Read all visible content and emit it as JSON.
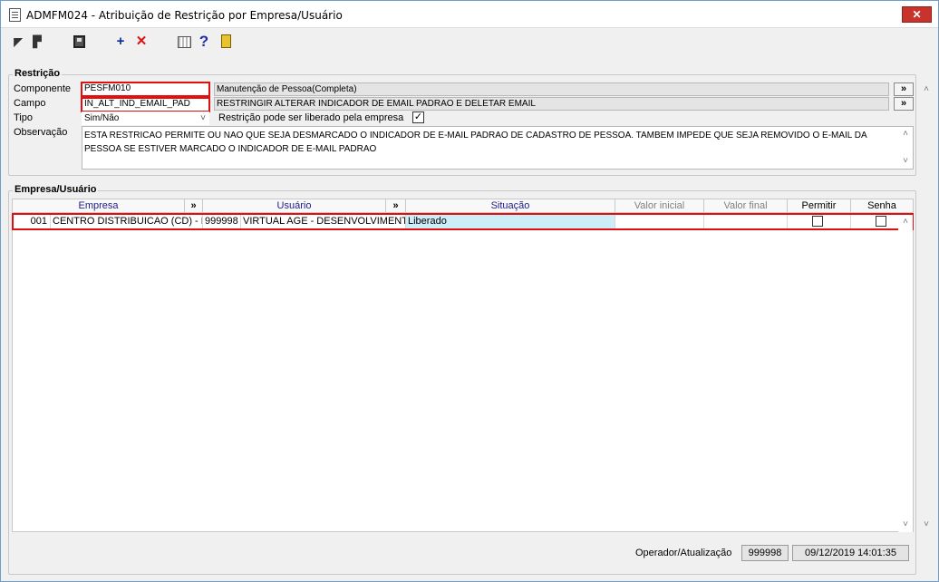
{
  "window": {
    "title": "ADMFM024 - Atribuição de Restrição por Empresa/Usuário",
    "close_glyph": "✕"
  },
  "toolbar": {
    "icons": [
      "first-record-icon",
      "previous-record-icon",
      "save-icon",
      "add-icon",
      "delete-icon",
      "calendar-icon",
      "help-icon",
      "exit-icon"
    ],
    "plus": "+",
    "x": "✕",
    "help": "?"
  },
  "restricao": {
    "group_title": "Restrição",
    "componente_label": "Componente",
    "componente_value": "PESFM010",
    "componente_desc": "Manutenção de Pessoa(Completa)",
    "campo_label": "Campo",
    "campo_value": "IN_ALT_IND_EMAIL_PAD",
    "campo_desc": "RESTRINGIR ALTERAR INDICADOR DE EMAIL PADRAO E DELETAR EMAIL",
    "tipo_label": "Tipo",
    "tipo_value": "Sim/Não",
    "liberado_label": "Restrição pode ser liberado pela empresa",
    "liberado_checked": true,
    "observacao_label": "Observação",
    "observacao_text": "ESTA RESTRICAO PERMITE OU NAO QUE SEJA DESMARCADO O INDICADOR DE E-MAIL PADRAO DE CADASTRO DE PESSOA. TAMBEM IMPEDE QUE SEJA REMOVIDO O E-MAIL DA PESSOA SE ESTIVER MARCADO O INDICADOR DE E-MAIL PADRAO",
    "nav_button": "»"
  },
  "empresa_usuario": {
    "group_title": "Empresa/Usuário",
    "columns": {
      "empresa": "Empresa",
      "usuario": "Usuário",
      "situacao": "Situação",
      "valor_inicial": "Valor inicial",
      "valor_final": "Valor final",
      "permitir": "Permitir",
      "senha": "Senha",
      "expand": "»"
    },
    "rows": [
      {
        "empresa_cod": "001",
        "empresa_nome": "CENTRO DISTRIBUICAO (CD) - FATURAMENTO",
        "usuario_cod": "999998",
        "usuario_nome": "VIRTUAL AGE - DESENVOLVIMENTO",
        "situacao": "Liberado",
        "valor_inicial": "",
        "valor_final": "",
        "permitir": false,
        "senha": false
      }
    ]
  },
  "footer": {
    "label": "Operador/Atualização",
    "operador": "999998",
    "atualizacao": "09/12/2019 14:01:35"
  },
  "scroll": {
    "up": "˄",
    "down": "˅"
  }
}
